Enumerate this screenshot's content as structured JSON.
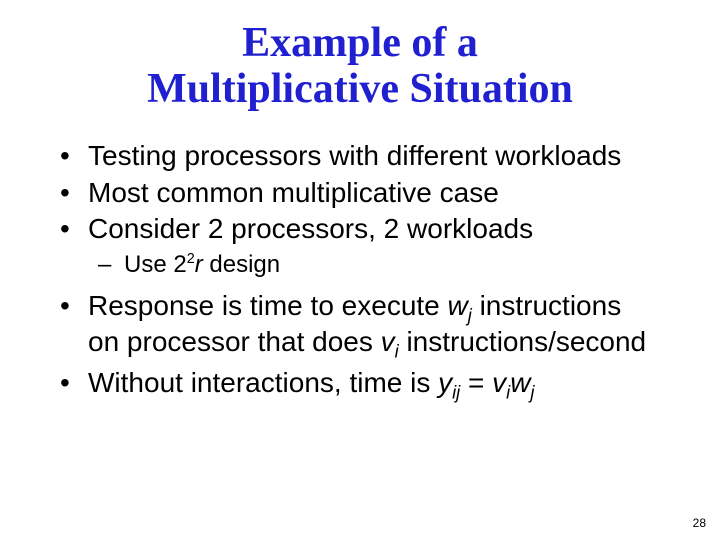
{
  "title_line1": "Example of a",
  "title_line2": "Multiplicative Situation",
  "b1": "Testing processors with different workloads",
  "b2": "Most common multiplicative case",
  "b3": "Consider 2 processors, 2 workloads",
  "b3a_pre": "Use 2",
  "b3a_sup": "2",
  "b3a_r": "r",
  "b3a_post": " design",
  "b4_pre": "Response is time to execute ",
  "b4_w": "w",
  "b4_j": "j",
  "b4_mid": " instructions on processor that does ",
  "b4_v": "v",
  "b4_i": "i",
  "b4_post": " instructions/second",
  "b5_pre": "Without interactions, time is ",
  "b5_y": "y",
  "b5_ij": "ij",
  "b5_eq": " = ",
  "b5_v": "v",
  "b5_i": "i",
  "b5_w": "w",
  "b5_j": "j",
  "page": "28"
}
